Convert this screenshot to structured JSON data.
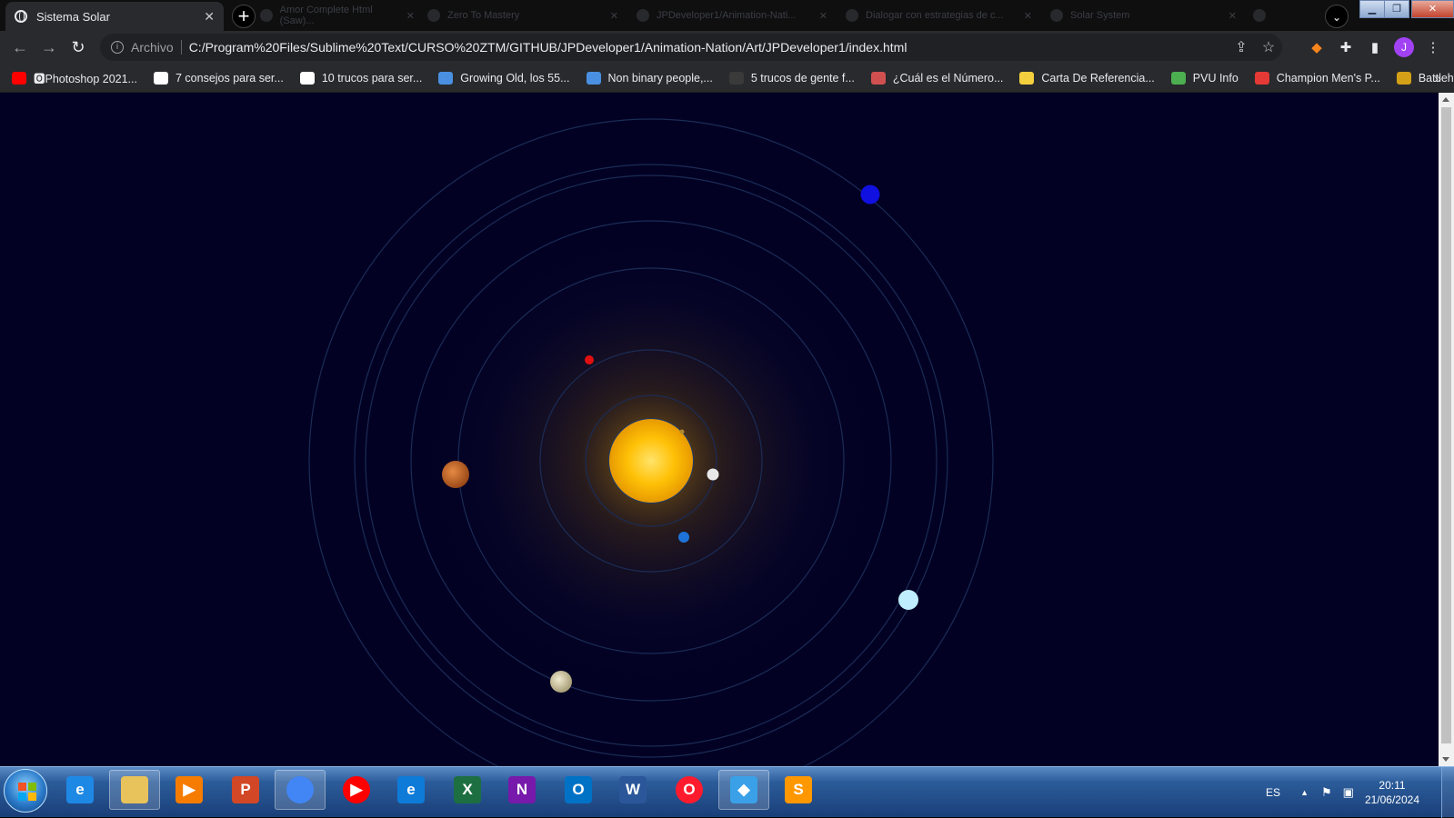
{
  "browser": {
    "active_tab": {
      "title": "Sistema Solar",
      "icon": "globe-icon"
    },
    "background_tabs": [
      {
        "title": "Amor Complete Html (Saw)..."
      },
      {
        "title": "Zero To Mastery"
      },
      {
        "title": "JPDeveloper1/Animation-Nati..."
      },
      {
        "title": "Dialogar con estrategias de c..."
      },
      {
        "title": "Solar System"
      }
    ],
    "address": {
      "security_label": "Archivo",
      "url": "C:/Program%20Files/Sublime%20Text/CURSO%20ZTM/GITHUB/JPDeveloper1/Animation-Nation/Art/JPDeveloper1/index.html"
    },
    "profile_initial": "J",
    "bookmarks": [
      {
        "label": "🅾Photoshop 2021...",
        "icon": "youtube-icon",
        "color": "#ff0000"
      },
      {
        "label": "7 consejos para ser...",
        "icon": "medium-icon",
        "color": "#ffffff"
      },
      {
        "label": "10 trucos para ser...",
        "icon": "e-icon",
        "color": "#ffffff"
      },
      {
        "label": "Growing Old, los 55...",
        "icon": "gear-icon",
        "color": "#4a90e2"
      },
      {
        "label": "Non binary people,...",
        "icon": "gear-icon",
        "color": "#4a90e2"
      },
      {
        "label": "5 trucos de gente f...",
        "icon": "film-icon",
        "color": "#3a3a3a"
      },
      {
        "label": "¿Cuál es el Número...",
        "icon": "flag-icon",
        "color": "#d05050"
      },
      {
        "label": "Carta De Referencia...",
        "icon": "flag-ve-icon",
        "color": "#f4d03f"
      },
      {
        "label": "PVU Info",
        "icon": "clover-icon",
        "color": "#4caf50"
      },
      {
        "label": "Champion Men's P...",
        "icon": "star-icon",
        "color": "#e53935"
      },
      {
        "label": "Battlehero",
        "icon": "battle-icon",
        "color": "#d4a017"
      }
    ],
    "more_bookmarks": "»"
  },
  "solar_system": {
    "background": "#020124",
    "sun_color": "#ffc107",
    "orbit_color": "#1b2c55",
    "planets": [
      {
        "name": "mercury",
        "color": "#b08a2e"
      },
      {
        "name": "venus",
        "color": "#e8e8e8"
      },
      {
        "name": "earth",
        "color": "#1e73d8"
      },
      {
        "name": "mars",
        "color": "#e01010"
      },
      {
        "name": "jupiter",
        "color": "#c8672a"
      },
      {
        "name": "saturn",
        "color": "#d8d0b0"
      },
      {
        "name": "uranus",
        "color": "#bfefff"
      },
      {
        "name": "neptune",
        "color": "#1010e0"
      }
    ]
  },
  "taskbar": {
    "apps": [
      {
        "name": "internet-explorer-icon",
        "label": "e",
        "color": "#1e88e5"
      },
      {
        "name": "file-explorer-icon",
        "label": "",
        "color": "#e8c25a"
      },
      {
        "name": "media-player-icon",
        "label": "▶",
        "color": "#f57c00"
      },
      {
        "name": "powerpoint-icon",
        "label": "P",
        "color": "#d24726"
      },
      {
        "name": "chrome-icon",
        "label": "",
        "color": "#4285f4"
      },
      {
        "name": "youtube-music-icon",
        "label": "▶",
        "color": "#ff0000"
      },
      {
        "name": "edge-icon",
        "label": "e",
        "color": "#0f7bd8"
      },
      {
        "name": "excel-icon",
        "label": "X",
        "color": "#1d6f42"
      },
      {
        "name": "onenote-icon",
        "label": "N",
        "color": "#7719aa"
      },
      {
        "name": "outlook-icon",
        "label": "O",
        "color": "#0072c6"
      },
      {
        "name": "word-icon",
        "label": "W",
        "color": "#2b579a"
      },
      {
        "name": "opera-icon",
        "label": "O",
        "color": "#ff1b2d"
      },
      {
        "name": "paint-icon",
        "label": "◆",
        "color": "#3aa0e8"
      },
      {
        "name": "sublime-text-icon",
        "label": "S",
        "color": "#ff9800"
      }
    ],
    "language": "ES",
    "time": "20:11",
    "date": "21/06/2024"
  }
}
